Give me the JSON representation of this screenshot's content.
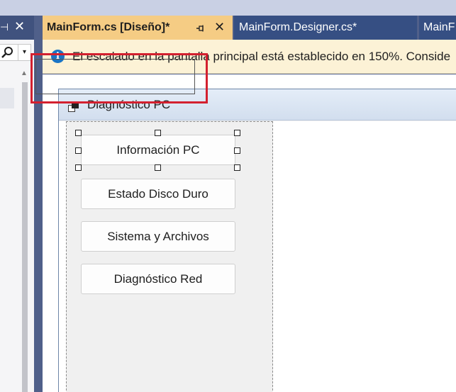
{
  "tabs": {
    "active": {
      "label": "MainForm.cs [Diseño]*",
      "pin_icon": "pin-icon",
      "close_glyph": "✕"
    },
    "second": {
      "label": "MainForm.Designer.cs*"
    },
    "third": {
      "label": "MainF"
    }
  },
  "left_panel": {
    "pin_glyph": "⊣",
    "close_glyph": "✕",
    "search_icon": "search-icon",
    "dropdown_glyph": "▾",
    "scroll_up_glyph": "▲"
  },
  "info_bar": {
    "icon": "info-icon",
    "icon_glyph": "i",
    "message": "El escalado en la pantalla principal está establecido en 150%. Conside"
  },
  "form": {
    "title": "Diagnóstico PC",
    "buttons": [
      {
        "label": "Información PC",
        "selected": true
      },
      {
        "label": "Estado Disco Duro"
      },
      {
        "label": "Sistema y Archivos"
      },
      {
        "label": "Diagnóstico Red"
      }
    ]
  },
  "colors": {
    "active_tab": "#f5cc84",
    "inactive_tab": "#364f83",
    "info_bar": "#fcf2d6",
    "selection_highlight": "#d3202f"
  }
}
